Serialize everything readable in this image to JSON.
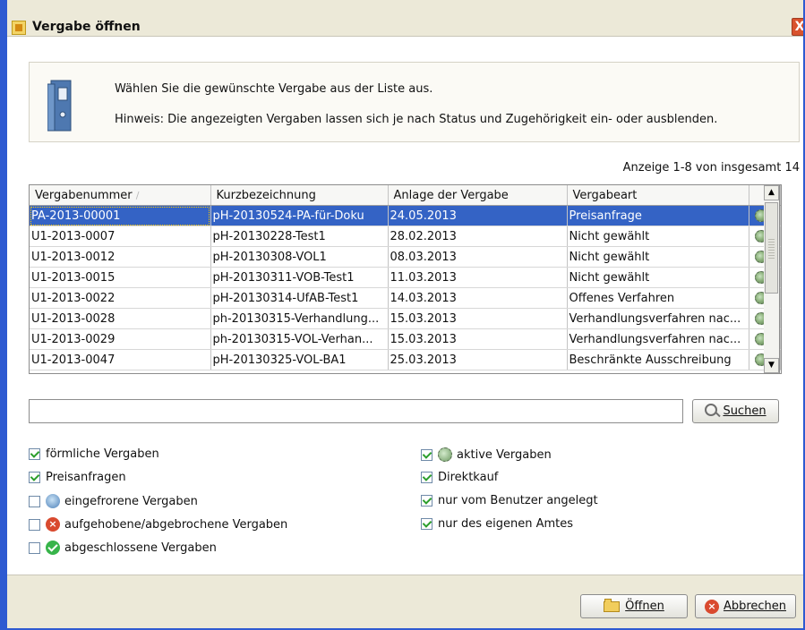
{
  "window": {
    "title": "Vergabe öffnen",
    "close_label": "X"
  },
  "info": {
    "line1": "Wählen Sie die gewünschte Vergabe aus der Liste aus.",
    "line2": "Hinweis: Die angezeigten Vergaben lassen sich je nach Status und Zugehörigkeit ein- oder ausblenden."
  },
  "count_text": "Anzeige 1-8 von insgesamt 14",
  "table": {
    "columns": [
      "Vergabenummer",
      "Kurzbezeichnung",
      "Anlage der Vergabe",
      "Vergabeart"
    ],
    "rows": [
      [
        "PA-2013-00001",
        "pH-20130524-PA-für-Doku",
        "24.05.2013",
        "Preisanfrage"
      ],
      [
        "U1-2013-0007",
        "pH-20130228-Test1",
        "28.02.2013",
        "Nicht gewählt"
      ],
      [
        "U1-2013-0012",
        "pH-20130308-VOL1",
        "08.03.2013",
        "Nicht gewählt"
      ],
      [
        "U1-2013-0015",
        "pH-20130311-VOB-Test1",
        "11.03.2013",
        "Nicht gewählt"
      ],
      [
        "U1-2013-0022",
        "pH-20130314-UfAB-Test1",
        "14.03.2013",
        "Offenes Verfahren"
      ],
      [
        "U1-2013-0028",
        "ph-20130315-Verhandlung...",
        "15.03.2013",
        "Verhandlungsverfahren nac..."
      ],
      [
        "U1-2013-0029",
        "ph-20130315-VOL-Verhan...",
        "15.03.2013",
        "Verhandlungsverfahren nac..."
      ],
      [
        "U1-2013-0047",
        "pH-20130325-VOL-BA1",
        "25.03.2013",
        "Beschränkte Ausschreibung"
      ]
    ],
    "selected_row": 0
  },
  "search": {
    "value": "",
    "button_label": "Suchen"
  },
  "filters_left": [
    {
      "label": "förmliche Vergaben",
      "checked": true,
      "icon": ""
    },
    {
      "label": "Preisanfragen",
      "checked": true,
      "icon": ""
    },
    {
      "label": "eingefrorene Vergaben",
      "checked": false,
      "icon": "frozen-icon"
    },
    {
      "label": "aufgehobene/abgebrochene Vergaben",
      "checked": false,
      "icon": "cancelled-icon"
    },
    {
      "label": "abgeschlossene Vergaben",
      "checked": false,
      "icon": "completed-icon"
    }
  ],
  "filters_right": [
    {
      "label": "aktive Vergaben",
      "checked": true,
      "icon": "active-gear-icon"
    },
    {
      "label": "Direktkauf",
      "checked": true,
      "icon": ""
    },
    {
      "label": "nur vom Benutzer angelegt",
      "checked": true,
      "icon": ""
    },
    {
      "label": "nur des eigenen Amtes",
      "checked": true,
      "icon": ""
    }
  ],
  "buttons": {
    "open_label": "Öffnen",
    "cancel_label": "Abbrechen"
  }
}
